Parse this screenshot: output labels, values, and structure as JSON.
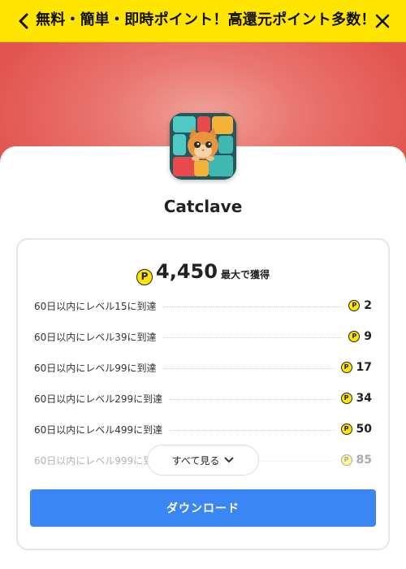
{
  "header": {
    "title": "無料・簡単・即時ポイント！高還元ポイント多数！",
    "back_icon": "chevron-left-icon",
    "close_icon": "close-icon",
    "background": "#ffe500"
  },
  "app": {
    "name": "Catclave",
    "icon": "app-icon-cat-puzzle"
  },
  "reward": {
    "coin_symbol": "P",
    "total": "4,450",
    "total_suffix": "最大で獲得"
  },
  "tasks": [
    {
      "label": "60日以内にレベル15に到達",
      "points": "2"
    },
    {
      "label": "60日以内にレベル39に到達",
      "points": "9"
    },
    {
      "label": "60日以内にレベル99に到達",
      "points": "17"
    },
    {
      "label": "60日以内にレベル299に到達",
      "points": "34"
    },
    {
      "label": "60日以内にレベル499に到達",
      "points": "50"
    },
    {
      "label": "60日以内にレベル999に到達",
      "points": "85"
    }
  ],
  "actions": {
    "see_all": "すべて見る",
    "download": "ダウンロード"
  },
  "colors": {
    "accent": "#3a86f4",
    "coin": "#ffe500",
    "hero": "#e35650"
  }
}
